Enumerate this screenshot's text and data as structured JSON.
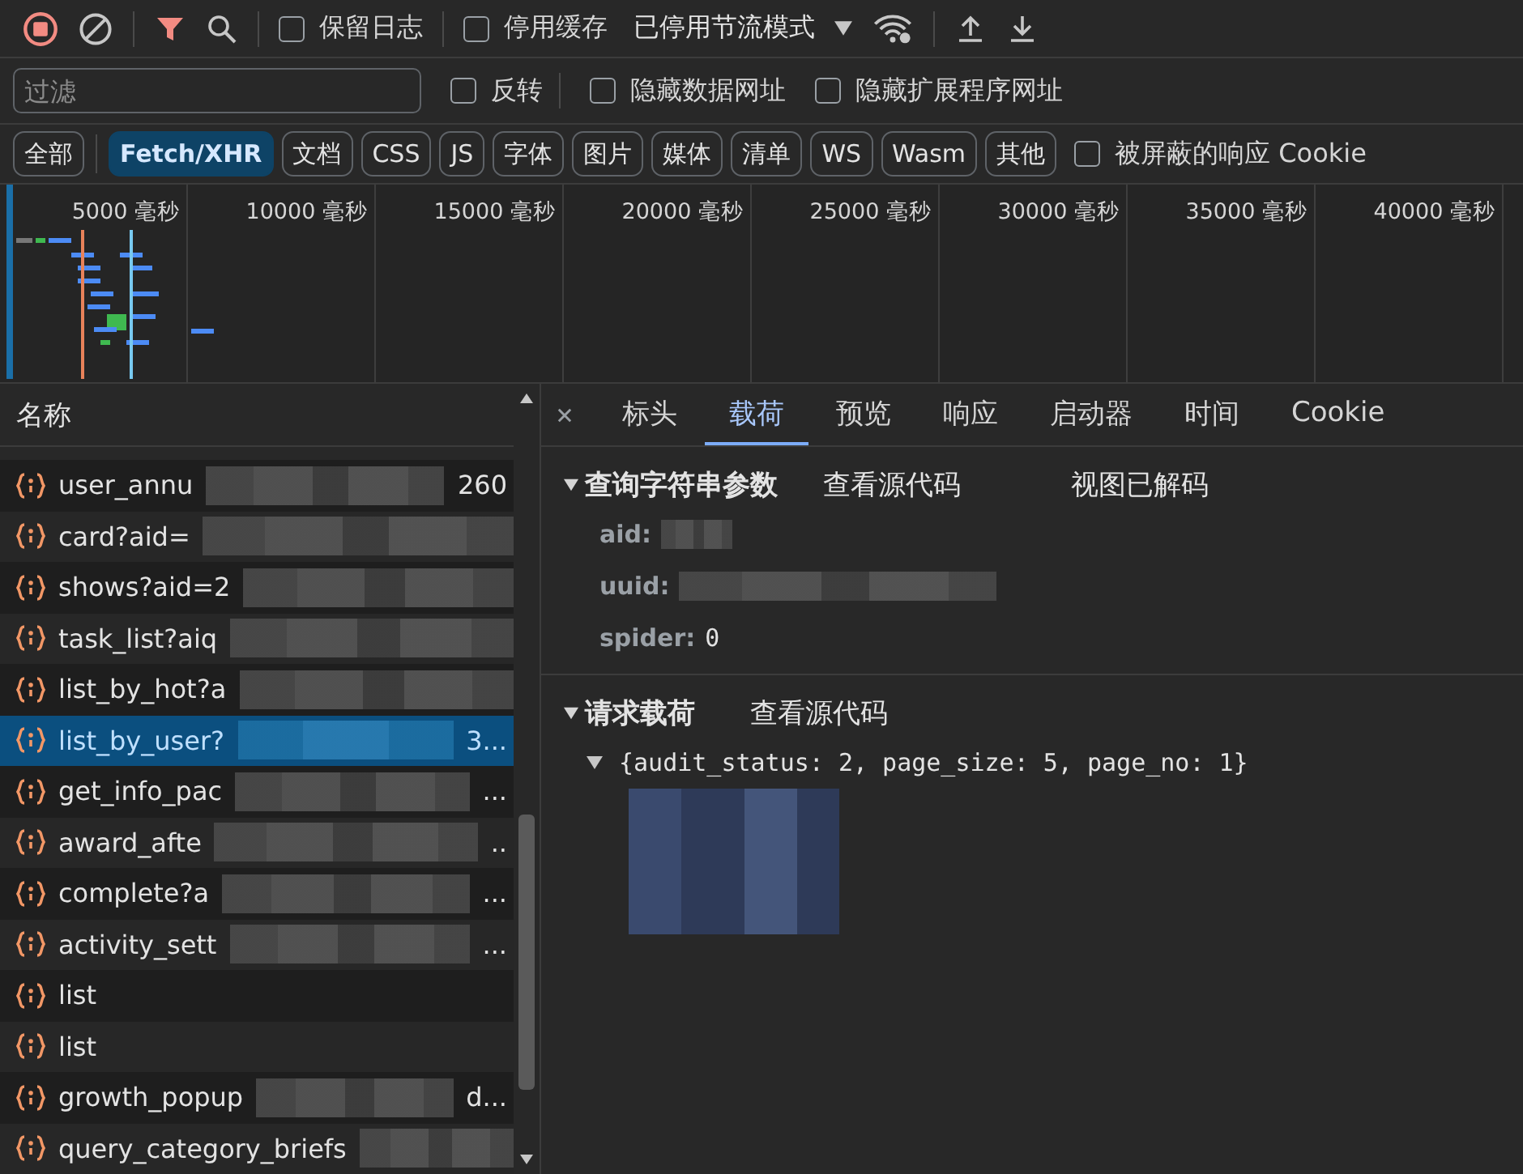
{
  "toolbar": {
    "preserve_log": {
      "label": "保留日志",
      "checked": false
    },
    "disable_cache": {
      "label": "停用缓存",
      "checked": false
    },
    "throttling": "已停用节流模式"
  },
  "filter_bar": {
    "placeholder": "过滤",
    "options": [
      {
        "label": "反转",
        "checked": false
      },
      {
        "label": "隐藏数据网址",
        "checked": false
      },
      {
        "label": "隐藏扩展程序网址",
        "checked": false
      }
    ]
  },
  "type_filters": [
    {
      "label": "全部",
      "selected": false
    },
    {
      "label": "Fetch/XHR",
      "selected": true
    },
    {
      "label": "文档",
      "selected": false
    },
    {
      "label": "CSS",
      "selected": false
    },
    {
      "label": "JS",
      "selected": false
    },
    {
      "label": "字体",
      "selected": false
    },
    {
      "label": "图片",
      "selected": false
    },
    {
      "label": "媒体",
      "selected": false
    },
    {
      "label": "清单",
      "selected": false
    },
    {
      "label": "WS",
      "selected": false
    },
    {
      "label": "Wasm",
      "selected": false
    },
    {
      "label": "其他",
      "selected": false
    }
  ],
  "blocked_cookies": {
    "label": "被屏蔽的响应 Cookie",
    "checked": false
  },
  "timeline": {
    "ticks": [
      "5000 毫秒",
      "10000 毫秒",
      "15000 毫秒",
      "20000 毫秒",
      "25000 毫秒",
      "30000 毫秒",
      "35000 毫秒",
      "40000 毫秒"
    ]
  },
  "request_list": {
    "header": "名称",
    "rows": [
      {
        "name": "user_annu",
        "tail": "260",
        "selected": false
      },
      {
        "name": "card?aid=",
        "selected": false
      },
      {
        "name": "shows?aid=2",
        "selected": false
      },
      {
        "name": "task_list?aiq",
        "selected": false
      },
      {
        "name": "list_by_hot?a",
        "selected": false
      },
      {
        "name": "list_by_user?",
        "tail": "3...",
        "selected": true
      },
      {
        "name": "get_info_pac",
        "tail": "...",
        "selected": false
      },
      {
        "name": "award_afte",
        "tail": "..",
        "selected": false
      },
      {
        "name": "complete?a",
        "tail": "...",
        "selected": false
      },
      {
        "name": "activity_sett",
        "tail": "...",
        "selected": false
      },
      {
        "name": "list",
        "selected": false
      },
      {
        "name": "list",
        "selected": false
      },
      {
        "name": "growth_popup",
        "tail": "d...",
        "selected": false
      },
      {
        "name": "query_category_briefs",
        "selected": false
      }
    ]
  },
  "detail_tabs": [
    {
      "label": "标头",
      "selected": false
    },
    {
      "label": "载荷",
      "selected": true
    },
    {
      "label": "预览",
      "selected": false
    },
    {
      "label": "响应",
      "selected": false
    },
    {
      "label": "启动器",
      "selected": false
    },
    {
      "label": "时间",
      "selected": false
    },
    {
      "label": "Cookie",
      "selected": false
    }
  ],
  "query_params": {
    "title": "查询字符串参数",
    "expanded": true,
    "links": [
      "查看源代码",
      "视图已解码"
    ],
    "params": [
      {
        "key": "aid:"
      },
      {
        "key": "uuid:"
      },
      {
        "key": "spider:",
        "value": "0"
      }
    ]
  },
  "request_payload": {
    "title": "请求载荷",
    "expanded": true,
    "links": [
      "查看源代码"
    ],
    "object": {
      "summary": "{audit_status: 2, page_size: 5, page_no: 1}",
      "expanded": true
    }
  }
}
